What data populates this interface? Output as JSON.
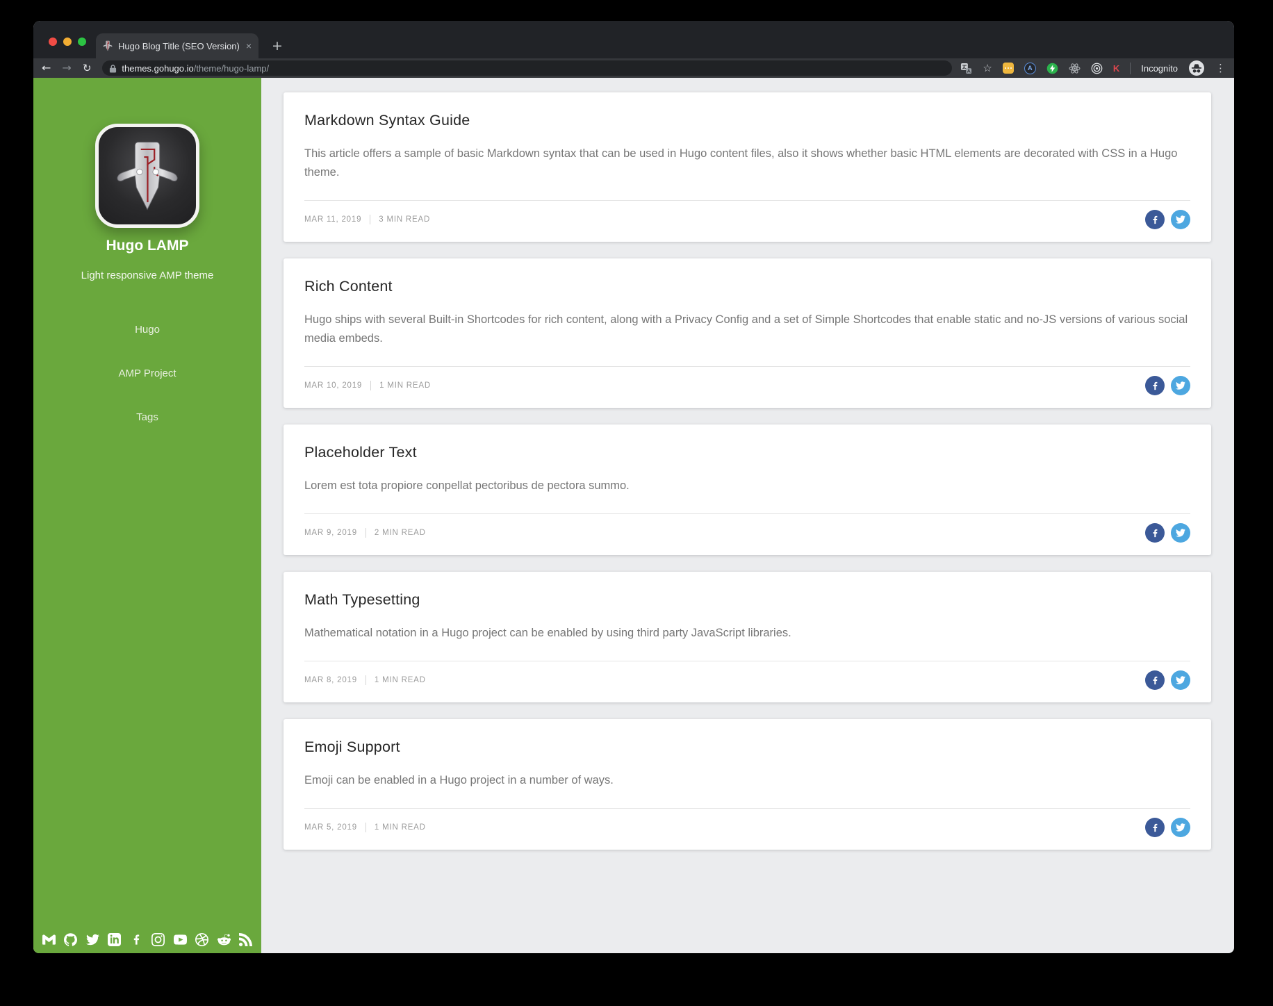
{
  "browser": {
    "tab_title": "Hugo Blog Title (SEO Version)",
    "url": {
      "host": "themes.gohugo.io",
      "path": "/theme/hugo-lamp/"
    },
    "incognito_label": "Incognito",
    "toolbar_icons": [
      "back-arrow-icon",
      "forward-arrow-icon",
      "reload-icon",
      "lock-icon",
      "translate-icon",
      "bookmark-star-icon",
      "extension-yellow-dots-icon",
      "extension-letter-a-icon",
      "amp-lightning-icon",
      "atom-icon",
      "concentric-circles-icon",
      "letter-k-icon",
      "incognito-spy-icon",
      "menu-dots-icon"
    ]
  },
  "sidebar": {
    "title": "Hugo LAMP",
    "subtitle": "Light responsive AMP theme",
    "nav": [
      "Hugo",
      "AMP Project",
      "Tags"
    ],
    "social": [
      "gmail",
      "github",
      "twitter",
      "linkedin",
      "facebook",
      "instagram",
      "youtube",
      "dribbble",
      "reddit",
      "rss"
    ]
  },
  "posts": [
    {
      "title": "Markdown Syntax Guide",
      "excerpt": "This article offers a sample of basic Markdown syntax that can be used in Hugo content files, also it shows whether basic HTML elements are decorated with CSS in a Hugo theme.",
      "date": "MAR 11, 2019",
      "read_time": "3 MIN READ"
    },
    {
      "title": "Rich Content",
      "excerpt": "Hugo ships with several Built-in Shortcodes for rich content, along with a Privacy Config and a set of Simple Shortcodes that enable static and no-JS versions of various social media embeds.",
      "date": "MAR 10, 2019",
      "read_time": "1 MIN READ"
    },
    {
      "title": "Placeholder Text",
      "excerpt": "Lorem est tota propiore conpellat pectoribus de pectora summo.",
      "date": "MAR 9, 2019",
      "read_time": "2 MIN READ"
    },
    {
      "title": "Math Typesetting",
      "excerpt": "Mathematical notation in a Hugo project can be enabled by using third party JavaScript libraries.",
      "date": "MAR 8, 2019",
      "read_time": "1 MIN READ"
    },
    {
      "title": "Emoji Support",
      "excerpt": "Emoji can be enabled in a Hugo project in a number of ways.",
      "date": "MAR 5, 2019",
      "read_time": "1 MIN READ"
    }
  ],
  "colors": {
    "sidebar_green": "#6aa83d",
    "facebook_blue": "#3b5998",
    "twitter_blue": "#4da7e0",
    "card_bg": "#ffffff",
    "page_bg": "#ebecee"
  }
}
